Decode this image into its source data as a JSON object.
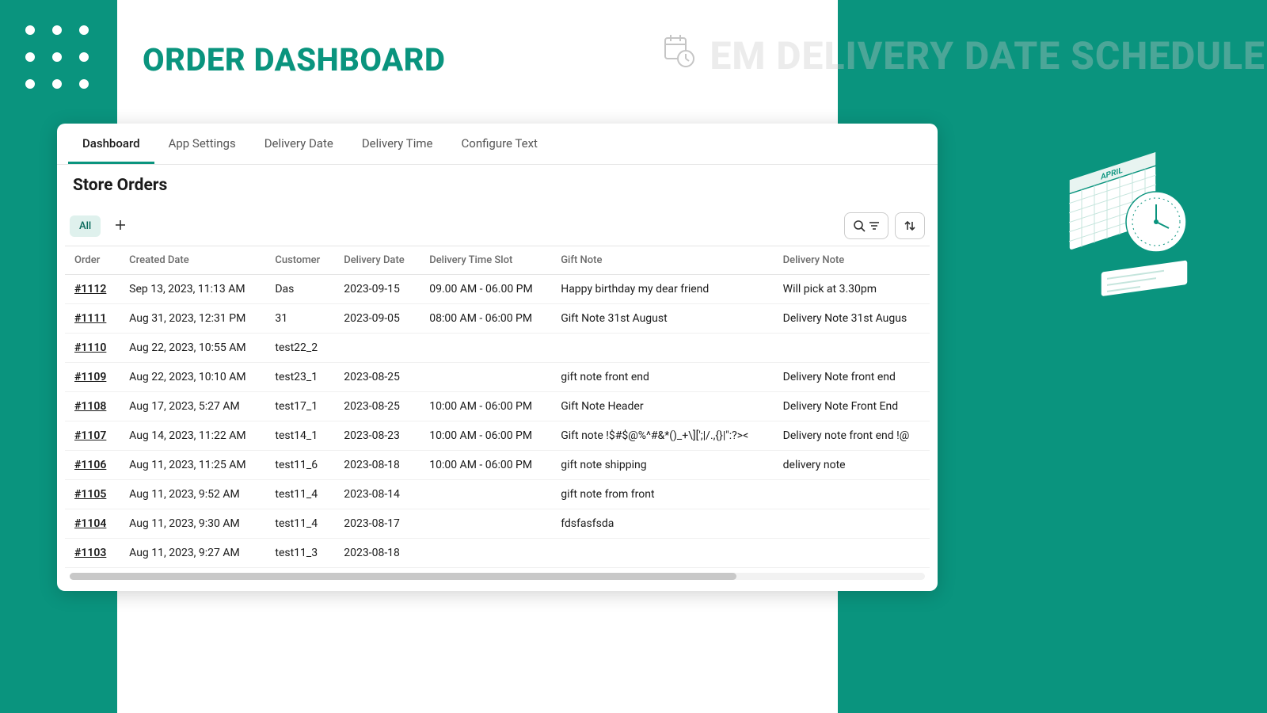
{
  "header": {
    "title": "ORDER DASHBOARD",
    "ghost_title": "EM DELIVERY DATE SCHEDULER"
  },
  "tabs": [
    {
      "label": "Dashboard",
      "active": true
    },
    {
      "label": "App Settings",
      "active": false
    },
    {
      "label": "Delivery Date",
      "active": false
    },
    {
      "label": "Delivery Time",
      "active": false
    },
    {
      "label": "Configure Text",
      "active": false
    }
  ],
  "section_title": "Store Orders",
  "filter_chip": "All",
  "columns": [
    "Order",
    "Created Date",
    "Customer",
    "Delivery Date",
    "Delivery Time Slot",
    "Gift Note",
    "Delivery Note"
  ],
  "rows": [
    {
      "order": "#1112",
      "created": "Sep 13, 2023, 11:13 AM",
      "customer": "Das",
      "delivery_date": "2023-09-15",
      "slot": "09.00 AM - 06.00 PM",
      "gift": "Happy birthday my dear friend",
      "note": "Will pick at 3.30pm"
    },
    {
      "order": "#1111",
      "created": "Aug 31, 2023, 12:31 PM",
      "customer": "31",
      "delivery_date": "2023-09-05",
      "slot": "08:00 AM - 06:00 PM",
      "gift": "Gift Note 31st August",
      "note": "Delivery Note 31st Augus"
    },
    {
      "order": "#1110",
      "created": "Aug 22, 2023, 10:55 AM",
      "customer": "test22_2",
      "delivery_date": "",
      "slot": "",
      "gift": "",
      "note": ""
    },
    {
      "order": "#1109",
      "created": "Aug 22, 2023, 10:10 AM",
      "customer": "test23_1",
      "delivery_date": "2023-08-25",
      "slot": "",
      "gift": "gift note front end",
      "note": "Delivery Note front end"
    },
    {
      "order": "#1108",
      "created": "Aug 17, 2023, 5:27 AM",
      "customer": "test17_1",
      "delivery_date": "2023-08-25",
      "slot": "10:00 AM - 06:00 PM",
      "gift": "Gift Note Header",
      "note": "Delivery Note Front End"
    },
    {
      "order": "#1107",
      "created": "Aug 14, 2023, 11:22 AM",
      "customer": "test14_1",
      "delivery_date": "2023-08-23",
      "slot": "10:00 AM - 06:00 PM",
      "gift": "Gift note !$#$@%^#&*()_+\\][';|/.,{}|\":?><",
      "note": "Delivery note front end !@"
    },
    {
      "order": "#1106",
      "created": "Aug 11, 2023, 11:25 AM",
      "customer": "test11_6",
      "delivery_date": "2023-08-18",
      "slot": "10:00 AM - 06:00 PM",
      "gift": "gift note shipping",
      "note": "delivery note"
    },
    {
      "order": "#1105",
      "created": "Aug 11, 2023, 9:52 AM",
      "customer": "test11_4",
      "delivery_date": "2023-08-14",
      "slot": "",
      "gift": "gift note from front",
      "note": ""
    },
    {
      "order": "#1104",
      "created": "Aug 11, 2023, 9:30 AM",
      "customer": "test11_4",
      "delivery_date": "2023-08-17",
      "slot": "",
      "gift": "fdsfasfsda",
      "note": ""
    },
    {
      "order": "#1103",
      "created": "Aug 11, 2023, 9:27 AM",
      "customer": "test11_3",
      "delivery_date": "2023-08-18",
      "slot": "",
      "gift": "",
      "note": ""
    }
  ],
  "icons": {
    "plus": "plus-icon",
    "search_filter": "search-filter-icon",
    "sort": "sort-icon",
    "calendar_clock": "calendar-clock-icon"
  },
  "colors": {
    "brand": "#0a947e",
    "chip_bg": "#dff1ed"
  }
}
